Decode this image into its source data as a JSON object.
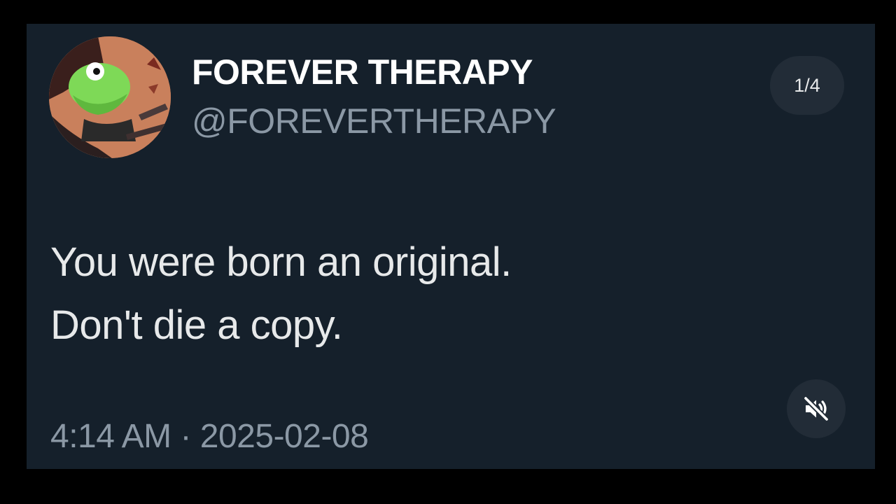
{
  "tweet": {
    "avatar": {
      "icon": "frog-avatar-icon",
      "alt": "profile picture"
    },
    "display_name": "FOREVER THERAPY",
    "handle": "@FOREVERTHERAPY",
    "text_lines": [
      "You were born an original.",
      "Don't die a copy."
    ],
    "time": "4:14 AM",
    "separator": "·",
    "date": "2025-02-08"
  },
  "media": {
    "counter": "1/4",
    "mute_icon": "speaker-muted-icon"
  },
  "colors": {
    "page_background": "#000000",
    "card_background": "#15202b",
    "primary_text": "#e7e9ea",
    "secondary_text": "#8b98a5",
    "pill_background": "#222c37"
  }
}
